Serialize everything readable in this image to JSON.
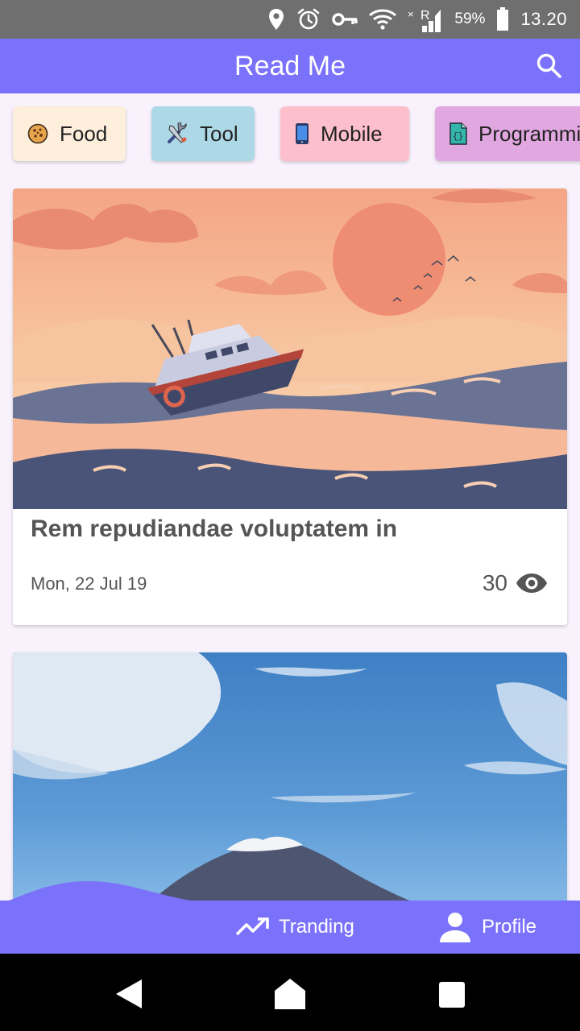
{
  "status_bar": {
    "battery": "59%",
    "time": "13.20",
    "icons": [
      "location-icon",
      "alarm-icon",
      "vpn-key-icon",
      "wifi-icon",
      "signal-icon",
      "battery-icon"
    ]
  },
  "app_bar": {
    "title": "Read Me",
    "search_icon": "search-icon"
  },
  "categories": [
    {
      "label": "Food",
      "icon": "cookie-icon",
      "color": "#fdefdc"
    },
    {
      "label": "Tool",
      "icon": "tools-icon",
      "color": "#add8e6"
    },
    {
      "label": "Mobile",
      "icon": "smartphone-icon",
      "color": "#fdbfcb"
    },
    {
      "label": "Programming",
      "icon": "code-file-icon",
      "color": "#e1a7e1"
    }
  ],
  "articles": [
    {
      "title": "Rem repudiandae voluptatem in",
      "date": "Mon, 22 Jul 19",
      "views": "30",
      "image": "sunset-boat-illustration"
    },
    {
      "image": "mountain-sky-photo"
    }
  ],
  "bottom_nav": {
    "items": [
      {
        "label": "Tranding",
        "icon": "trending-up-icon"
      },
      {
        "label": "Profile",
        "icon": "person-icon"
      }
    ]
  },
  "colors": {
    "primary": "#7b72fb",
    "background": "#f9f2fd",
    "status_bar": "#6f6f6f"
  }
}
